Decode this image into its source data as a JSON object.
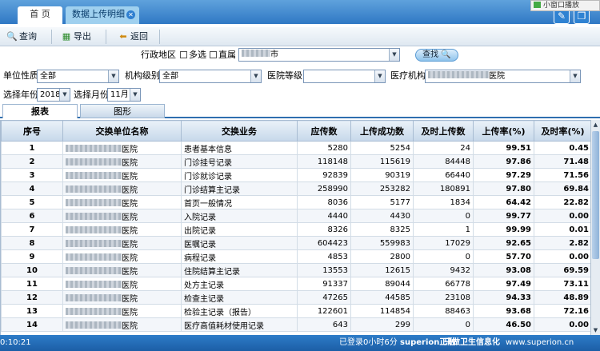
{
  "tabs": [
    {
      "label": "首 页"
    },
    {
      "label": "数据上传明细"
    }
  ],
  "widget": {
    "label": "小窗口播放"
  },
  "toolbar": {
    "query": "查询",
    "export": "导出",
    "back": "返回"
  },
  "filters": {
    "region_label": "行政地区",
    "multi_label": "多选",
    "direct_label": "直属",
    "region_value": "市",
    "search_label": "查找",
    "unit_type_label": "单位性质",
    "unit_type_value": "全部",
    "org_level_label": "机构级别",
    "org_level_value": "全部",
    "hospital_grade_label": "医院等级",
    "hospital_grade_value": "",
    "institution_label": "医疗机构",
    "institution_value": "医院",
    "year_label": "选择年份",
    "year_value": "2018",
    "month_label": "选择月份",
    "month_value": "11月"
  },
  "view_tabs": {
    "table": "报表",
    "chart": "图形"
  },
  "table": {
    "headers": [
      "序号",
      "交换单位名称",
      "交换业务",
      "应传数",
      "上传成功数",
      "及时上传数",
      "上传率(%)",
      "及时率(%)"
    ],
    "rows": [
      [
        "1",
        "医院",
        "患者基本信息",
        "5280",
        "5254",
        "24",
        "99.51",
        "0.45"
      ],
      [
        "2",
        "医院",
        "门诊挂号记录",
        "118148",
        "115619",
        "84448",
        "97.86",
        "71.48"
      ],
      [
        "3",
        "医院",
        "门诊就诊记录",
        "92839",
        "90319",
        "66440",
        "97.29",
        "71.56"
      ],
      [
        "4",
        "医院",
        "门诊结算主记录",
        "258990",
        "253282",
        "180891",
        "97.80",
        "69.84"
      ],
      [
        "5",
        "医院",
        "首页一般情况",
        "8036",
        "5177",
        "1834",
        "64.42",
        "22.82"
      ],
      [
        "6",
        "医院",
        "入院记录",
        "4440",
        "4430",
        "0",
        "99.77",
        "0.00"
      ],
      [
        "7",
        "医院",
        "出院记录",
        "8326",
        "8325",
        "1",
        "99.99",
        "0.01"
      ],
      [
        "8",
        "医院",
        "医嘱记录",
        "604423",
        "559983",
        "17029",
        "92.65",
        "2.82"
      ],
      [
        "9",
        "医院",
        "病程记录",
        "4853",
        "2800",
        "0",
        "57.70",
        "0.00"
      ],
      [
        "10",
        "医院",
        "住院结算主记录",
        "13553",
        "12615",
        "9432",
        "93.08",
        "69.59"
      ],
      [
        "11",
        "医院",
        "处方主记录",
        "91337",
        "89044",
        "66778",
        "97.49",
        "73.11"
      ],
      [
        "12",
        "医院",
        "检查主记录",
        "47265",
        "44585",
        "23108",
        "94.33",
        "48.89"
      ],
      [
        "13",
        "医院",
        "检验主记录（报告）",
        "122601",
        "114854",
        "88463",
        "93.68",
        "72.16"
      ],
      [
        "14",
        "医院",
        "医疗高值耗材使用记录",
        "643",
        "299",
        "0",
        "46.50",
        "0.00"
      ]
    ]
  },
  "status": {
    "clock": "0:10:21",
    "login": "已登录0小时6分",
    "brand": "superion正融",
    "slogan": "只做卫生信息化",
    "url": "www.superion.cn"
  }
}
